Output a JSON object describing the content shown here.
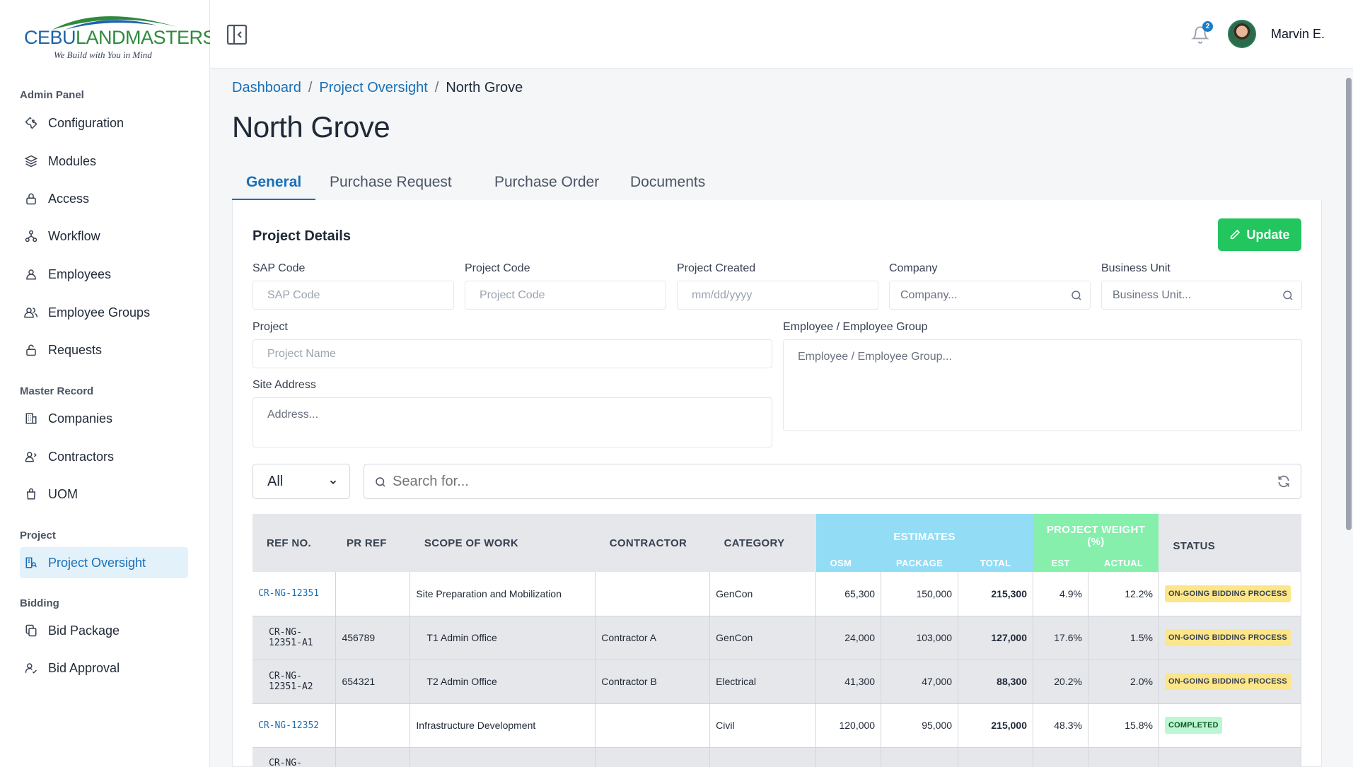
{
  "brand": {
    "name_part1": "CEBU",
    "name_part2": "LANDMASTERS",
    "tagline": "We Build with You in Mind"
  },
  "sidebar": {
    "sections": [
      {
        "title": "Admin Panel",
        "items": [
          {
            "label": "Configuration",
            "icon": "wrench-icon"
          },
          {
            "label": "Modules",
            "icon": "layers-icon"
          },
          {
            "label": "Access",
            "icon": "lock-icon"
          },
          {
            "label": "Workflow",
            "icon": "workflow-icon"
          },
          {
            "label": "Employees",
            "icon": "user-icon"
          },
          {
            "label": "Employee Groups",
            "icon": "users-icon"
          },
          {
            "label": "Requests",
            "icon": "unlock-icon"
          }
        ]
      },
      {
        "title": "Master Record",
        "items": [
          {
            "label": "Companies",
            "icon": "building-icon"
          },
          {
            "label": "Contractors",
            "icon": "contractor-icon"
          },
          {
            "label": "UOM",
            "icon": "bag-icon"
          }
        ]
      },
      {
        "title": "Project",
        "items": [
          {
            "label": "Project Oversight",
            "icon": "oversight-icon",
            "active": true
          }
        ]
      },
      {
        "title": "Bidding",
        "items": [
          {
            "label": "Bid Package",
            "icon": "copy-icon"
          },
          {
            "label": "Bid Approval",
            "icon": "user-check-icon"
          }
        ]
      }
    ]
  },
  "topbar": {
    "notification_count": "2",
    "user_name": "Marvin E."
  },
  "breadcrumb": {
    "items": [
      "Dashboard",
      "Project Oversight"
    ],
    "separator": "/",
    "current": "North Grove"
  },
  "page_title": "North Grove",
  "tabs": [
    "General",
    "Purchase Request",
    "Purchase Order",
    "Documents"
  ],
  "project_details": {
    "title": "Project Details",
    "update_label": "Update",
    "fields": {
      "sap_code": {
        "label": "SAP Code",
        "placeholder": "SAP Code"
      },
      "project_code": {
        "label": "Project Code",
        "placeholder": "Project Code"
      },
      "project_created": {
        "label": "Project Created",
        "placeholder": "mm/dd/yyyy"
      },
      "company": {
        "label": "Company",
        "placeholder": "Company..."
      },
      "business_unit": {
        "label": "Business Unit",
        "placeholder": "Business Unit..."
      },
      "project": {
        "label": "Project",
        "placeholder": "Project Name"
      },
      "employee_group": {
        "label": "Employee / Employee Group",
        "placeholder": "Employee / Employee Group..."
      },
      "site_address": {
        "label": "Site Address",
        "placeholder": "Address..."
      }
    }
  },
  "filter": {
    "selected": "All",
    "search_placeholder": "Search for..."
  },
  "table": {
    "headers": {
      "ref_no": "REF NO.",
      "pr_ref": "PR REF",
      "scope": "SCOPE OF WORK",
      "contractor": "CONTRACTOR",
      "category": "CATEGORY",
      "estimates": "ESTIMATES",
      "osm": "OSM",
      "package": "PACKAGE",
      "total": "TOTAL",
      "project_weight": "PROJECT WEIGHT (%)",
      "est": "EST",
      "actual": "ACTUAL",
      "status": "STATUS"
    },
    "rows": [
      {
        "ref": "CR-NG-12351",
        "pr_ref": "",
        "scope": "Site Preparation and Mobilization",
        "contractor": "",
        "category": "GenCon",
        "osm": "65,300",
        "package": "150,000",
        "total": "215,300",
        "est": "4.9%",
        "actual": "12.2%",
        "status": "ON-GOING BIDDING PROCESS",
        "child": false
      },
      {
        "ref": "CR-NG-12351-A1",
        "pr_ref": "456789",
        "scope": "T1 Admin Office",
        "contractor": "Contractor A",
        "category": "GenCon",
        "osm": "24,000",
        "package": "103,000",
        "total": "127,000",
        "est": "17.6%",
        "actual": "1.5%",
        "status": "ON-GOING BIDDING PROCESS",
        "child": true
      },
      {
        "ref": "CR-NG-12351-A2",
        "pr_ref": "654321",
        "scope": "T2 Admin Office",
        "contractor": "Contractor B",
        "category": "Electrical",
        "osm": "41,300",
        "package": "47,000",
        "total": "88,300",
        "est": "20.2%",
        "actual": "2.0%",
        "status": "ON-GOING BIDDING PROCESS",
        "child": true
      },
      {
        "ref": "CR-NG-12352",
        "pr_ref": "",
        "scope": "Infrastructure Development",
        "contractor": "",
        "category": "Civil",
        "osm": "120,000",
        "package": "95,000",
        "total": "215,000",
        "est": "48.3%",
        "actual": "15.8%",
        "status": "COMPLETED",
        "child": false
      },
      {
        "ref": "CR-NG-",
        "pr_ref": "",
        "scope": "",
        "contractor": "",
        "category": "",
        "osm": "",
        "package": "",
        "total": "",
        "est": "",
        "actual": "",
        "status": "",
        "child": true
      }
    ]
  },
  "colors": {
    "accent": "#1a6fb5",
    "update_button": "#22c55e",
    "estimates_header": "#93dcf5",
    "weight_header": "#86efac",
    "ongoing_badge": "#fde68a",
    "completed_badge": "#bbf7d0"
  }
}
